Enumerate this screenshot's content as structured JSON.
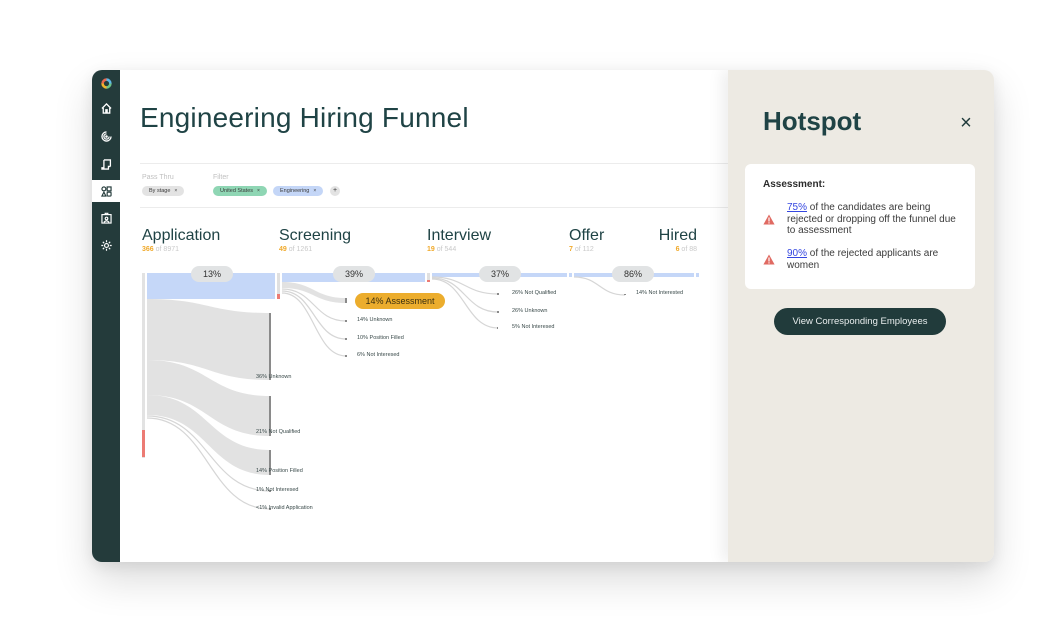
{
  "sidebar": {
    "items": [
      {
        "name": "logo",
        "active": false
      },
      {
        "name": "home",
        "active": false
      },
      {
        "name": "analytics",
        "active": false
      },
      {
        "name": "reports",
        "active": false
      },
      {
        "name": "funnels",
        "active": true
      },
      {
        "name": "employees",
        "active": false
      },
      {
        "name": "settings",
        "active": false
      }
    ]
  },
  "main": {
    "title": "Engineering Hiring Funnel",
    "pass_thru": {
      "label": "Pass Thru",
      "value": "By stage"
    },
    "filter": {
      "label": "Filter",
      "chips": [
        "United States",
        "Engineering"
      ],
      "add_label": "+"
    },
    "chip_close": "×"
  },
  "funnel": {
    "stages": [
      {
        "name": "Application",
        "highlight": "366",
        "of": "of 8971"
      },
      {
        "name": "Screening",
        "highlight": "49",
        "of": "of 1261"
      },
      {
        "name": "Interview",
        "highlight": "19",
        "of": "of 544"
      },
      {
        "name": "Offer",
        "highlight": "7",
        "of": "of 112"
      },
      {
        "name": "Hired",
        "highlight": "6",
        "of": "of 88"
      }
    ],
    "pass_rates": [
      "13%",
      "39%",
      "37%",
      "86%"
    ],
    "dropoffs": {
      "application": [
        {
          "label": "36% Unknown",
          "pct": 36
        },
        {
          "label": "21% Not Qualified",
          "pct": 21
        },
        {
          "label": "14% Position Filled",
          "pct": 14
        },
        {
          "label": "1% Not Interesed",
          "pct": 1
        },
        {
          "label": "<1% Invalid Application",
          "pct": 0.5
        }
      ],
      "screening": [
        {
          "label": "14% Assessment",
          "pct": 14,
          "hotspot": true
        },
        {
          "label": "14% Unknown",
          "pct": 14
        },
        {
          "label": "10% Position Filled",
          "pct": 10
        },
        {
          "label": "6% Not Interesed",
          "pct": 6
        }
      ],
      "interview": [
        {
          "label": "26% Not Qualified",
          "pct": 26
        },
        {
          "label": "26% Unknown",
          "pct": 26
        },
        {
          "label": "5% Not Interesed",
          "pct": 5
        }
      ],
      "offer": [
        {
          "label": "14% Not Interested",
          "pct": 14
        }
      ]
    },
    "colors": {
      "pass": "#c5d7f8",
      "drop": "#e2e2e2",
      "flag": "#ec7b74",
      "hotspot": "#ecad2d"
    }
  },
  "hotspot": {
    "title": "Hotspot",
    "close_label": "×",
    "card_title": "Assessment:",
    "insights": [
      {
        "link": "75%",
        "text": " of the candidates are being rejected or dropping off the funnel due to assessment"
      },
      {
        "link": "90%",
        "text": " of the rejected applicants are women"
      }
    ],
    "button_label": "View Corresponding Employees"
  }
}
